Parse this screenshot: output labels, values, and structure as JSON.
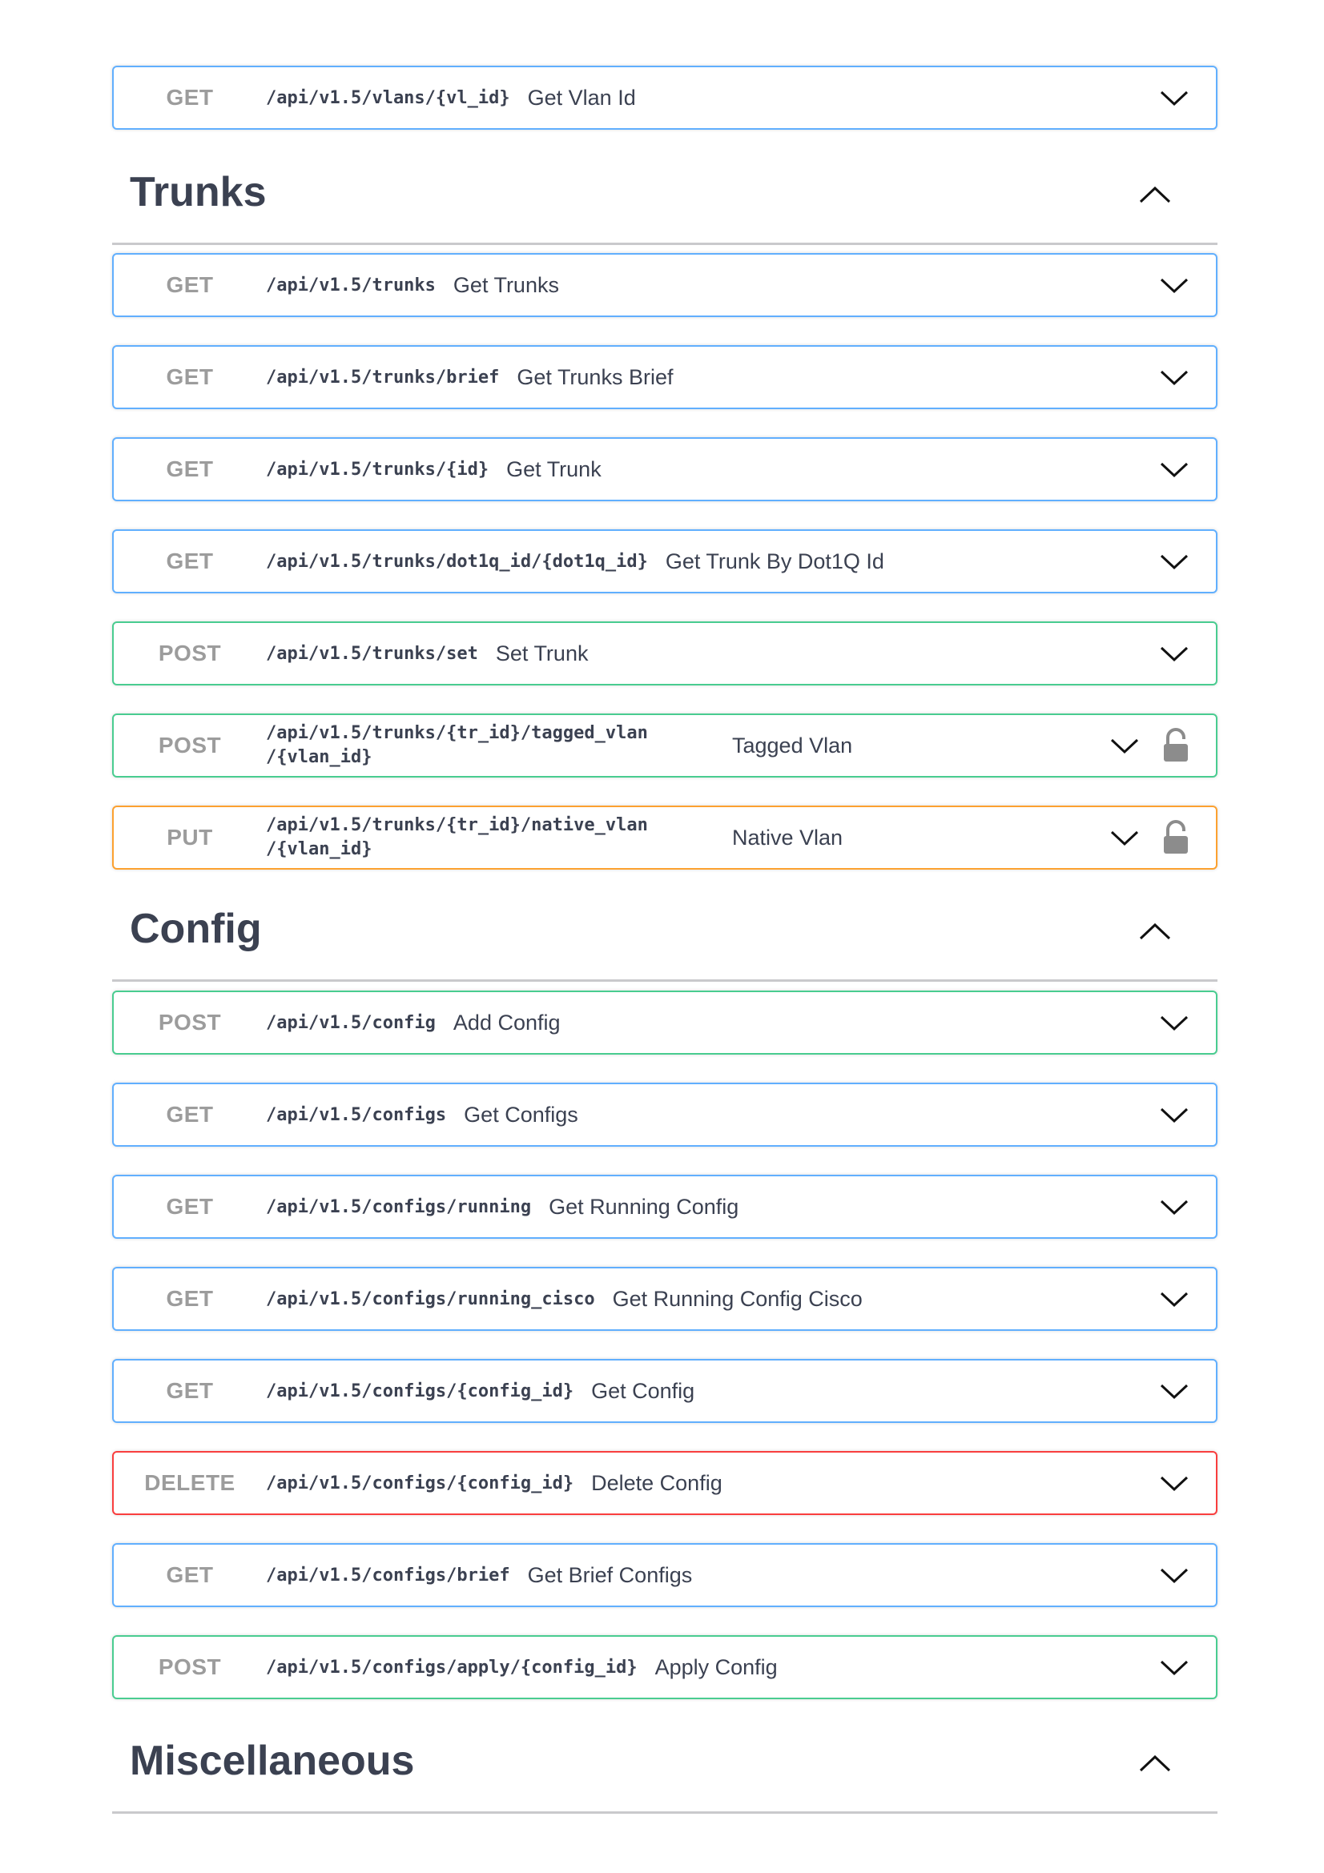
{
  "vlans": {
    "ops": [
      {
        "method": "GET",
        "path": "/api/v1.5/vlans/{vl_id}",
        "summary": "Get Vlan Id"
      }
    ]
  },
  "trunks": {
    "title": "Trunks",
    "ops": [
      {
        "method": "GET",
        "path": "/api/v1.5/trunks",
        "summary": "Get Trunks"
      },
      {
        "method": "GET",
        "path": "/api/v1.5/trunks/brief",
        "summary": "Get Trunks Brief"
      },
      {
        "method": "GET",
        "path": "/api/v1.5/trunks/{id}",
        "summary": "Get Trunk"
      },
      {
        "method": "GET",
        "path": "/api/v1.5/trunks/dot1q_id/{dot1q_id}",
        "summary": "Get Trunk By Dot1Q Id"
      },
      {
        "method": "POST",
        "path": "/api/v1.5/trunks/set",
        "summary": "Set Trunk"
      },
      {
        "method": "POST",
        "path_line1": "/api/v1.5/trunks/{tr_id}/tagged_vlan",
        "path_line2": "/{vlan_id}",
        "summary": "Tagged Vlan",
        "locked": true
      },
      {
        "method": "PUT",
        "path_line1": "/api/v1.5/trunks/{tr_id}/native_vlan",
        "path_line2": "/{vlan_id}",
        "summary": "Native Vlan",
        "locked": true
      }
    ]
  },
  "config": {
    "title": "Config",
    "ops": [
      {
        "method": "POST",
        "path": "/api/v1.5/config",
        "summary": "Add Config"
      },
      {
        "method": "GET",
        "path": "/api/v1.5/configs",
        "summary": "Get Configs"
      },
      {
        "method": "GET",
        "path": "/api/v1.5/configs/running",
        "summary": "Get Running Config"
      },
      {
        "method": "GET",
        "path": "/api/v1.5/configs/running_cisco",
        "summary": "Get Running Config Cisco"
      },
      {
        "method": "GET",
        "path": "/api/v1.5/configs/{config_id}",
        "summary": "Get Config"
      },
      {
        "method": "DELETE",
        "path": "/api/v1.5/configs/{config_id}",
        "summary": "Delete Config"
      },
      {
        "method": "GET",
        "path": "/api/v1.5/configs/brief",
        "summary": "Get Brief Configs"
      },
      {
        "method": "POST",
        "path": "/api/v1.5/configs/apply/{config_id}",
        "summary": "Apply Config"
      }
    ]
  },
  "misc": {
    "title": "Miscellaneous"
  },
  "colors": {
    "get": "#61affe",
    "post": "#49cc90",
    "put": "#fca130",
    "delete": "#f93e3e",
    "method_text": "#9c9c9c",
    "title_text": "#3b4151"
  },
  "icons": {
    "expand": "chevron-down-icon",
    "collapse": "chevron-up-icon",
    "lock": "unlocked-padlock-icon"
  }
}
